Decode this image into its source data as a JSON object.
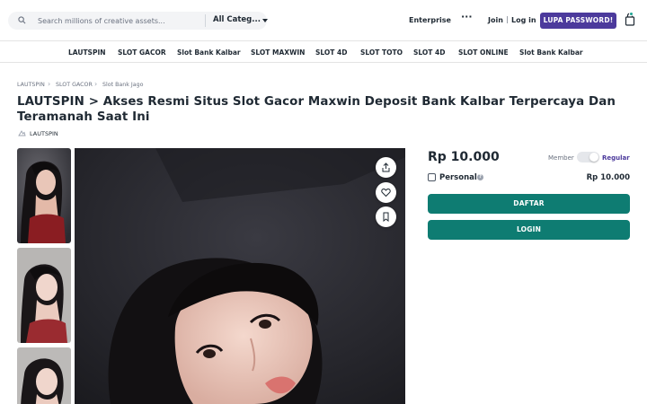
{
  "header": {
    "search_placeholder": "Search millions of creative assets...",
    "category_select": "All Categ...",
    "enterprise": "Enterprise",
    "more": "···",
    "join": "Join",
    "separator": "|",
    "login": "Log in",
    "lupa_password": "LUPA PASSWORD!"
  },
  "categories": [
    "LAUTSPIN",
    "SLOT GACOR",
    "Slot Bank Kalbar",
    "SLOT MAXWIN",
    "SLOT 4D",
    "SLOT TOTO",
    "SLOT 4D",
    "SLOT ONLINE",
    "Slot Bank Kalbar"
  ],
  "breadcrumb": [
    "LAUTSPIN",
    "SLOT GACOR",
    "Slot Bank Jago"
  ],
  "page_title": "LAUTSPIN > Akses Resmi Situs Slot Gacor Maxwin Deposit Bank Kalbar Terpercaya Dan Teramanah Saat Ini",
  "author": "LAUTSPIN",
  "product": {
    "price": "Rp 10.000",
    "member_label": "Member",
    "license_selected": "Regular",
    "personal_label": "Personal",
    "personal_checked": false,
    "personal_price": "Rp 10.000",
    "daftar_label": "DAFTAR",
    "login_label": "LOGIN"
  },
  "colors": {
    "brand_purple": "#4c3a9c",
    "brand_green": "#0e7c72",
    "cart_badge": "#1ea593"
  },
  "icons": [
    "search-icon",
    "chevron-down-icon",
    "more-icon",
    "cart-icon",
    "share-icon",
    "heart-icon",
    "bookmark-icon",
    "help-icon",
    "author-icon"
  ]
}
